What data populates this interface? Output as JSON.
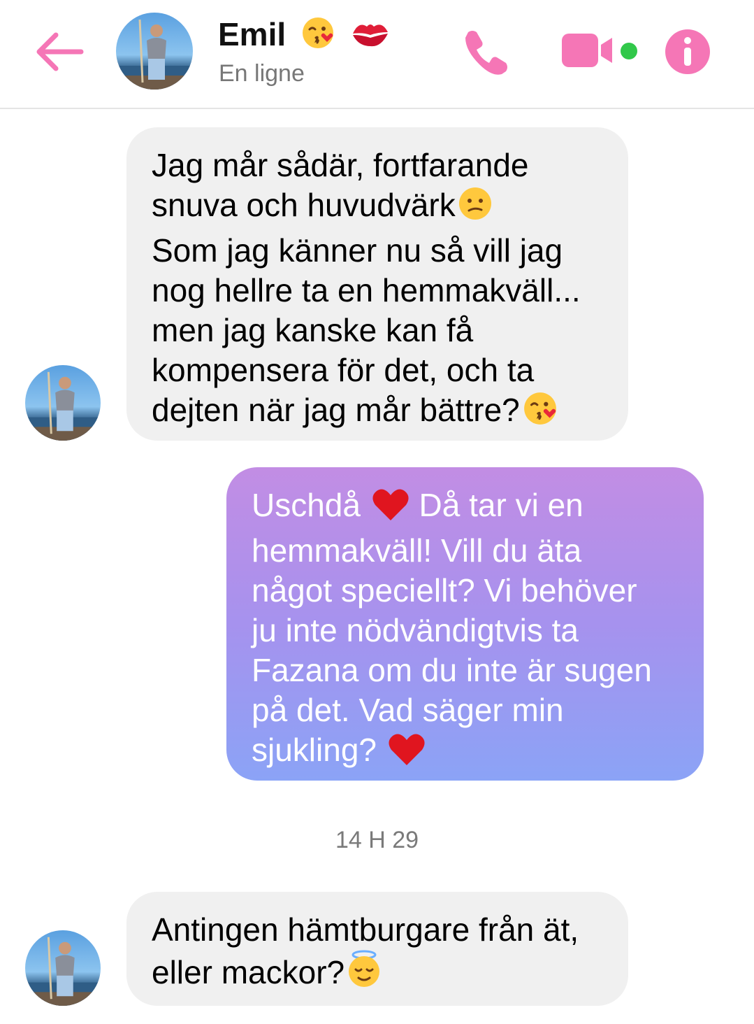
{
  "header": {
    "contact_name": "Emil",
    "name_emojis": [
      "kissing-face-heart-emoji",
      "kiss-mark-emoji"
    ],
    "status": "En ligne",
    "icons": [
      "back-arrow-icon",
      "phone-icon",
      "video-camera-icon",
      "info-icon"
    ],
    "accent_color": "#f576b6",
    "online_color": "#31c84a"
  },
  "messages": [
    {
      "direction": "incoming",
      "lines": [
        "Jag mår sådär, fortfarande",
        "snuva och huvudvärk",
        "Som jag känner nu så vill jag",
        "nog hellre ta en hemmakväll...",
        "men jag kanske kan få",
        "kompensera för det, och ta",
        "dejten när jag mår bättre?"
      ]
    },
    {
      "direction": "outgoing",
      "lines": [
        "Uschdå",
        "Då tar vi en",
        "hemmakväll! Vill du äta",
        "något speciellt? Vi behöver",
        "ju inte nödvändigtvis ta",
        "Fazana om du inte är sugen",
        "på det. Vad säger min",
        "sjukling?"
      ]
    },
    {
      "direction": "incoming",
      "lines": [
        "Antingen hämtburgare från ät,",
        "eller mackor?"
      ]
    }
  ],
  "timestamp": "14 H 29",
  "emojis": {
    "confused": "confused-face-emoji",
    "kiss": "kissing-face-heart-emoji",
    "heart": "red-heart-emoji",
    "relieved": "smiling-face-halo-emoji"
  }
}
